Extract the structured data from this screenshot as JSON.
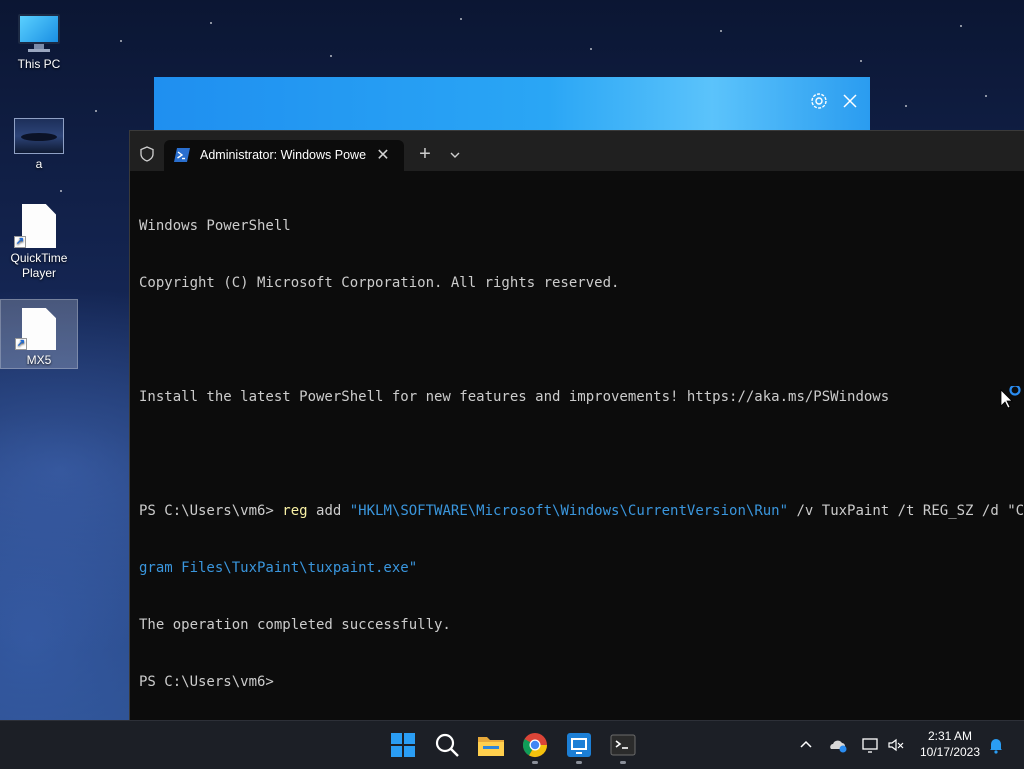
{
  "desktop": {
    "icons": [
      {
        "label": "This PC",
        "icon": "this-pc-icon"
      },
      {
        "label": "a",
        "icon": "image-file-icon"
      },
      {
        "label": "QuickTime Player",
        "icon": "file-shortcut-icon"
      },
      {
        "label": "MX5",
        "icon": "file-shortcut-icon"
      }
    ]
  },
  "banner": {
    "settings_icon": "gear-icon",
    "close_icon": "close-icon"
  },
  "terminal": {
    "tab_title": "Administrator: Windows PowerShell",
    "tab_close": "✕",
    "new_tab": "+",
    "lines": {
      "l1": "Windows PowerShell",
      "l2": "Copyright (C) Microsoft Corporation. All rights reserved.",
      "l3": "Install the latest PowerShell for new features and improvements! https://aka.ms/PSWindows",
      "prompt1": "PS C:\\Users\\vm6> ",
      "cmd_name": "reg",
      "cmd_sub": " add ",
      "cmd_key": "\"HKLM\\SOFTWARE\\Microsoft\\Windows\\CurrentVersion\\Run\"",
      "cmd_args": " /v TuxPaint /t REG_SZ /d \"C:\\Pro",
      "cmd_cont": "gram Files\\TuxPaint\\tuxpaint.exe\"",
      "result": "The operation completed successfully.",
      "prompt2": "PS C:\\Users\\vm6>"
    }
  },
  "taskbar": {
    "apps": [
      "start-icon",
      "search-icon",
      "file-explorer-icon",
      "chrome-icon",
      "remote-desktop-icon",
      "terminal-icon"
    ],
    "tray": {
      "chevron": "^",
      "time": "2:31 AM",
      "date": "10/17/2023"
    }
  },
  "colors": {
    "console_bg": "#0c0c0c",
    "console_text": "#cccccc",
    "command": "#f9f1a5",
    "string": "#3a96dd",
    "banner": "#2aa6f5",
    "taskbar": "#1c1f26"
  }
}
